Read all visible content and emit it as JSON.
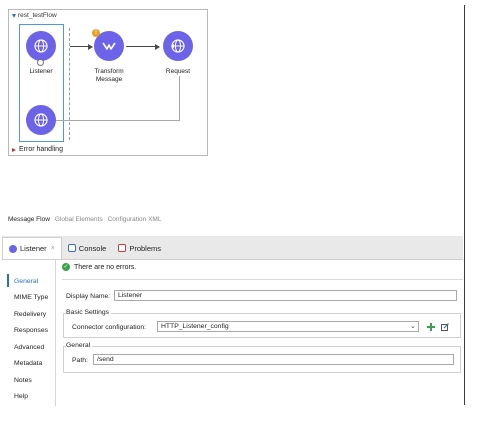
{
  "flow": {
    "title": "rest_testFlow",
    "nodes": [
      {
        "label": "Listener"
      },
      {
        "label": "Transform\nMessage"
      },
      {
        "label": "Request"
      }
    ],
    "error_handling": "Error handling",
    "warning_mark": "!"
  },
  "editor_tabs": [
    "Message Flow",
    "Global Elements",
    "Configuration XML"
  ],
  "panel_tabs": [
    {
      "label": "Listener",
      "close": "×"
    },
    {
      "label": "Console"
    },
    {
      "label": "Problems"
    }
  ],
  "nav": {
    "items": [
      "General",
      "MIME Type",
      "Redelivery",
      "Responses",
      "Advanced",
      "Metadata",
      "Notes",
      "Help"
    ]
  },
  "status": {
    "text": "There are no errors.",
    "icon": "✓"
  },
  "form": {
    "display_name_label": "Display Name:",
    "display_name_value": "Listener",
    "basic_settings_title": "Basic Settings",
    "connector_label": "Connector configuration:",
    "connector_value": "HTTP_Listener_config",
    "general_title": "General",
    "path_label": "Path:",
    "path_value": "/send"
  },
  "colors": {
    "node": "#6c63e8",
    "lane": "#4d9ad6",
    "accent": "#2c6fb7",
    "ok": "#3aa34a",
    "warning": "#e8a020"
  }
}
